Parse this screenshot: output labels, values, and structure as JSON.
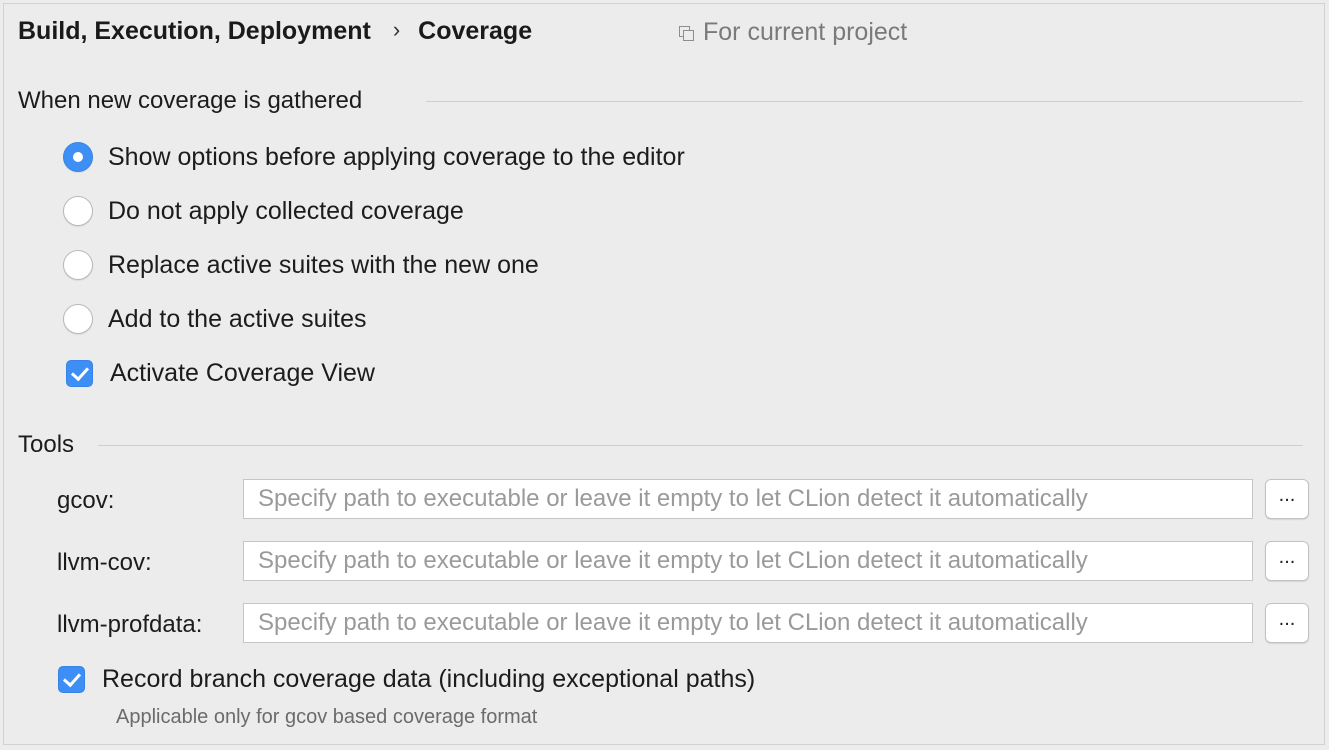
{
  "breadcrumb": {
    "parent": "Build, Execution, Deployment",
    "separator": "›",
    "current": "Coverage"
  },
  "scope_label": "For current project",
  "coverage_section": {
    "title": "When new coverage is gathered",
    "options": [
      {
        "label": "Show options before applying coverage to the editor",
        "selected": true
      },
      {
        "label": "Do not apply collected coverage",
        "selected": false
      },
      {
        "label": "Replace active suites with the new one",
        "selected": false
      },
      {
        "label": "Add to the active suites",
        "selected": false
      }
    ],
    "activate_view": {
      "label": "Activate Coverage View",
      "checked": true
    }
  },
  "tools_section": {
    "title": "Tools",
    "tools": [
      {
        "label": "gcov:",
        "value": "",
        "placeholder": "Specify path to executable or leave it empty to let CLion detect it automatically",
        "browse_label": "..."
      },
      {
        "label": "llvm-cov:",
        "value": "",
        "placeholder": "Specify path to executable or leave it empty to let CLion detect it automatically",
        "browse_label": "..."
      },
      {
        "label": "llvm-profdata:",
        "value": "",
        "placeholder": "Specify path to executable or leave it empty to let CLion detect it automatically",
        "browse_label": "..."
      }
    ],
    "branch_coverage": {
      "label": "Record branch coverage data (including exceptional paths)",
      "checked": true
    },
    "hint": "Applicable only for gcov based coverage format"
  },
  "colors": {
    "accent": "#3d8ff5",
    "background": "#ececec",
    "placeholder": "#9a9a9a",
    "hint": "#6b6b6b"
  }
}
